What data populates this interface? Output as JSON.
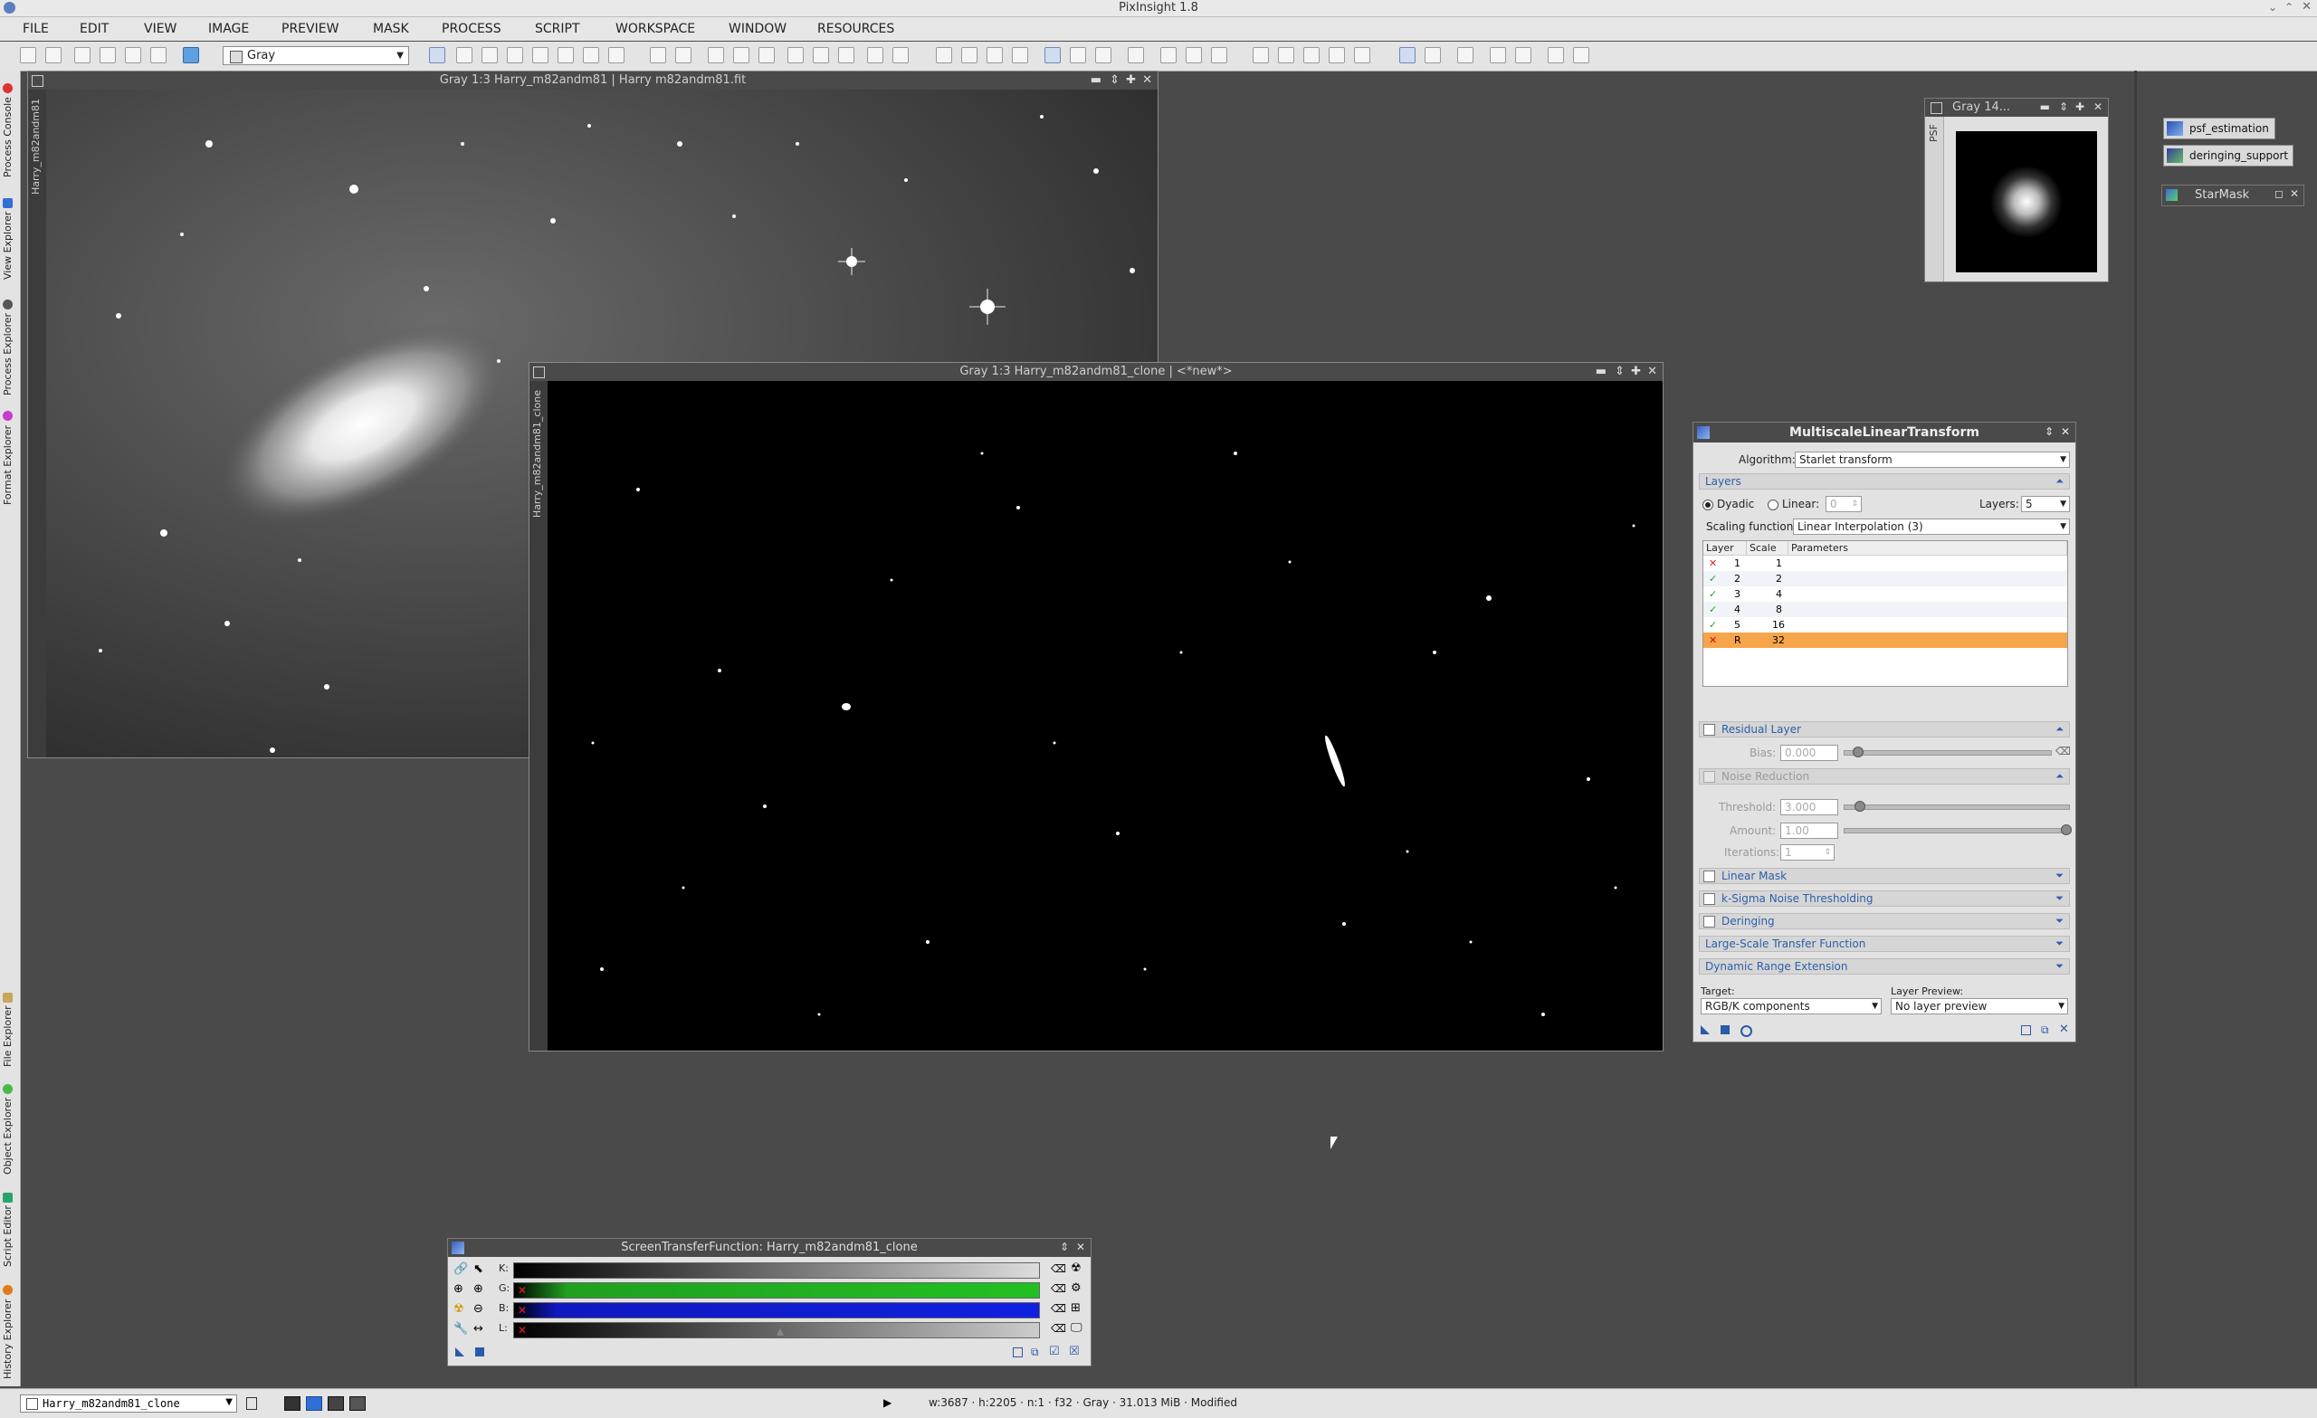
{
  "app": {
    "title": "PixInsight 1.8"
  },
  "menu": [
    "FILE",
    "EDIT",
    "VIEW",
    "IMAGE",
    "PREVIEW",
    "MASK",
    "PROCESS",
    "SCRIPT",
    "WORKSPACE",
    "WINDOW",
    "RESOURCES"
  ],
  "toolbar": {
    "view_mode": "Gray"
  },
  "left_tabs": [
    "Process Console",
    "View Explorer",
    "Process Explorer",
    "Format Explorer",
    "File Explorer",
    "Object Explorer",
    "Script Editor",
    "History Explorer"
  ],
  "windows": {
    "main": {
      "title": "Gray 1:3 Harry_m82andm81 | Harry m82andm81.fit",
      "side_label": "Harry_m82andm81"
    },
    "clone": {
      "title": "Gray 1:3 Harry_m82andm81_clone | <*new*>",
      "side_label": "Harry_m82andm81_clone"
    },
    "psf": {
      "title": "Gray 14...",
      "side_label": "PSF"
    }
  },
  "process_icons": [
    "psf_estimation",
    "deringing_support",
    "StarMask"
  ],
  "mlt": {
    "title": "MultiscaleLinearTransform",
    "algorithm_label": "Algorithm:",
    "algorithm_value": "Starlet transform",
    "layers_section": "Layers",
    "dyadic_label": "Dyadic",
    "linear_label": "Linear:",
    "linear_value": "0",
    "layers_label": "Layers:",
    "layers_value": "5",
    "scaling_label": "Scaling function:",
    "scaling_value": "Linear Interpolation (3)",
    "table_headers": [
      "Layer",
      "Scale",
      "Parameters"
    ],
    "rows": [
      {
        "mark": "✕",
        "layer": "1",
        "scale": "1"
      },
      {
        "mark": "✓",
        "layer": "2",
        "scale": "2"
      },
      {
        "mark": "✓",
        "layer": "3",
        "scale": "4"
      },
      {
        "mark": "✓",
        "layer": "4",
        "scale": "8"
      },
      {
        "mark": "✓",
        "layer": "5",
        "scale": "16"
      },
      {
        "mark": "✕",
        "layer": "R",
        "scale": "32"
      }
    ],
    "residual_section": "Residual Layer",
    "bias_label": "Bias:",
    "bias_value": "0.000",
    "noise_section": "Noise Reduction",
    "threshold_label": "Threshold:",
    "threshold_value": "3.000",
    "amount_label": "Amount:",
    "amount_value": "1.00",
    "iterations_label": "Iterations:",
    "iterations_value": "1",
    "linear_mask_section": "Linear Mask",
    "ksigma_section": "k-Sigma Noise Thresholding",
    "deringing_section": "Deringing",
    "lstf_section": "Large-Scale Transfer Function",
    "dre_section": "Dynamic Range Extension",
    "target_label": "Target:",
    "target_value": "RGB/K components",
    "preview_label": "Layer Preview:",
    "preview_value": "No layer preview"
  },
  "stf": {
    "title": "ScreenTransferFunction: Harry_m82andm81_clone",
    "channels": [
      "K:",
      "G:",
      "B:",
      "L:"
    ]
  },
  "status": {
    "view": "Harry_m82andm81_clone",
    "info": "w:3687  ·  h:2205  ·  n:1  ·  f32  ·  Gray  ·  31.013 MiB  ·  Modified"
  }
}
